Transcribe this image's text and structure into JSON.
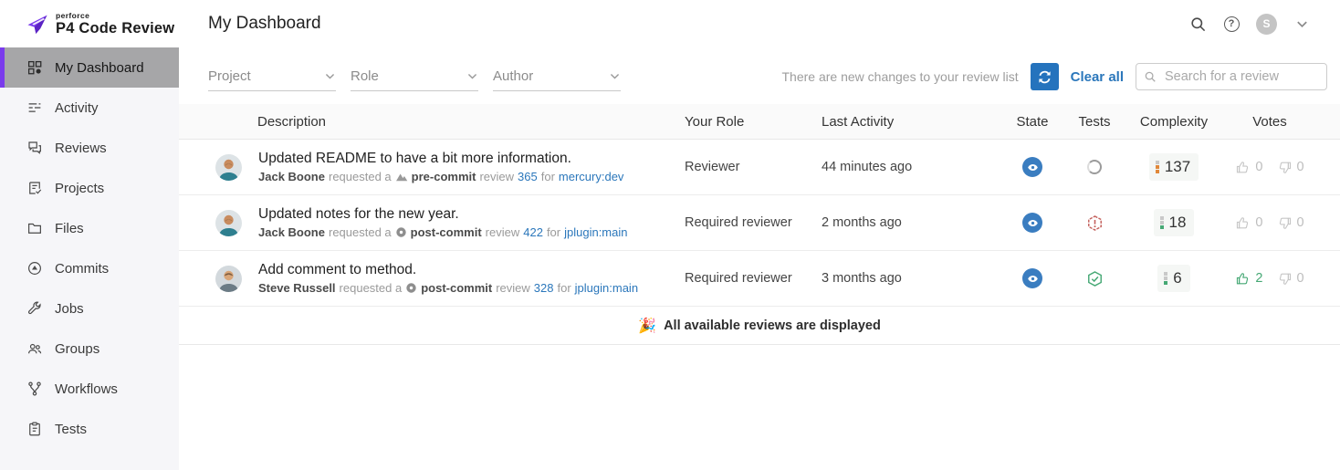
{
  "brand": {
    "supertitle": "perforce",
    "title": "P4 Code Review"
  },
  "topbar": {
    "page_title": "My Dashboard",
    "avatar_initial": "S"
  },
  "sidebar": {
    "items": [
      {
        "label": "My Dashboard",
        "icon": "dashboard-icon",
        "active": true
      },
      {
        "label": "Activity",
        "icon": "activity-icon",
        "active": false
      },
      {
        "label": "Reviews",
        "icon": "reviews-icon",
        "active": false
      },
      {
        "label": "Projects",
        "icon": "projects-icon",
        "active": false
      },
      {
        "label": "Files",
        "icon": "files-icon",
        "active": false
      },
      {
        "label": "Commits",
        "icon": "commits-icon",
        "active": false
      },
      {
        "label": "Jobs",
        "icon": "jobs-icon",
        "active": false
      },
      {
        "label": "Groups",
        "icon": "groups-icon",
        "active": false
      },
      {
        "label": "Workflows",
        "icon": "workflows-icon",
        "active": false
      },
      {
        "label": "Tests",
        "icon": "tests-icon",
        "active": false
      }
    ]
  },
  "filters": {
    "project_label": "Project",
    "role_label": "Role",
    "author_label": "Author",
    "notice": "There are new changes to your review list",
    "clear_all_label": "Clear all",
    "search_placeholder": "Search for a review"
  },
  "table": {
    "headers": {
      "description": "Description",
      "your_role": "Your Role",
      "last_activity": "Last Activity",
      "state": "State",
      "tests": "Tests",
      "complexity": "Complexity",
      "votes": "Votes"
    },
    "rows": [
      {
        "title": "Updated README to have a bit more information.",
        "author": "Jack Boone",
        "requested": "requested a",
        "commit_type": "pre-commit",
        "review_word": "review",
        "review_id": "365",
        "for_word": "for",
        "target": "mercury:dev",
        "role": "Reviewer",
        "last_activity": "44 minutes ago",
        "state": "needs-review",
        "tests_status": "running",
        "complexity_value": "137",
        "complexity_level": "high",
        "votes_up": "0",
        "votes_down": "0",
        "votes_up_state": "inactive"
      },
      {
        "title": "Updated notes for the new year.",
        "author": "Jack Boone",
        "requested": "requested a",
        "commit_type": "post-commit",
        "review_word": "review",
        "review_id": "422",
        "for_word": "for",
        "target": "jplugin:main",
        "role": "Required reviewer",
        "last_activity": "2 months ago",
        "state": "needs-review",
        "tests_status": "failed",
        "complexity_value": "18",
        "complexity_level": "low",
        "votes_up": "0",
        "votes_down": "0",
        "votes_up_state": "inactive"
      },
      {
        "title": "Add comment to method.",
        "author": "Steve Russell",
        "requested": "requested a",
        "commit_type": "post-commit",
        "review_word": "review",
        "review_id": "328",
        "for_word": "for",
        "target": "jplugin:main",
        "role": "Required reviewer",
        "last_activity": "3 months ago",
        "state": "needs-review",
        "tests_status": "passed",
        "complexity_value": "6",
        "complexity_level": "low",
        "votes_up": "2",
        "votes_down": "0",
        "votes_up_state": "active"
      }
    ]
  },
  "footer": {
    "emoji": "🎉",
    "message": "All available reviews are displayed"
  },
  "colors": {
    "accent_purple": "#7a3bec",
    "link_blue": "#2b77bb",
    "state_blue": "#3a7dc0",
    "pass_green": "#45a874",
    "fail_red": "#c4605c",
    "complexity_orange": "#e0883a"
  }
}
